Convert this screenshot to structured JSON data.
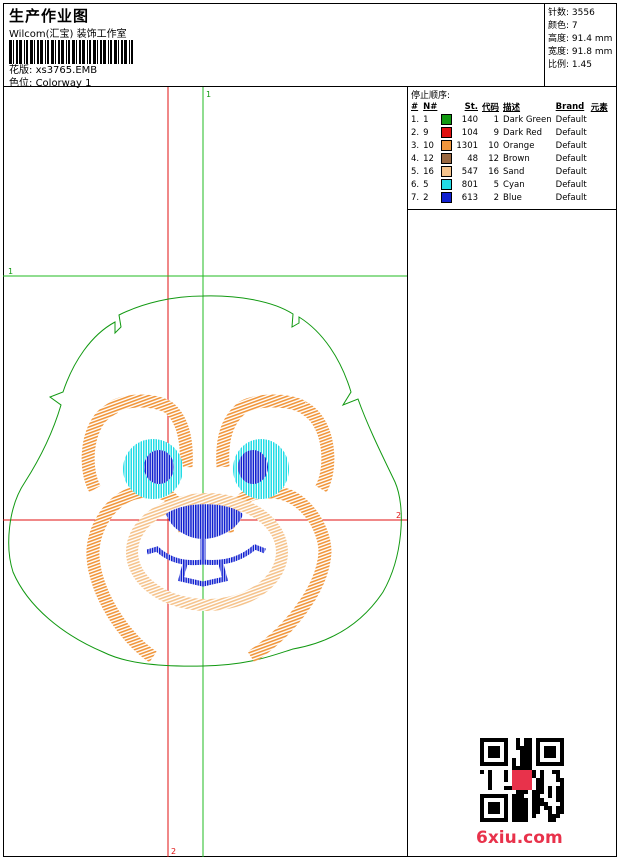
{
  "header": {
    "title": "生产作业图",
    "software": "Wilcom(汇宝) 装饰工作室",
    "design_label": "花版:",
    "design_value": "xs3765.EMB",
    "colorway_label": "色位:",
    "colorway_value": "Colorway 1"
  },
  "stats": [
    {
      "label": "针数:",
      "value": "3556"
    },
    {
      "label": "颜色:",
      "value": "7"
    },
    {
      "label": "高度:",
      "value": "91.4 mm"
    },
    {
      "label": "宽度:",
      "value": "91.8 mm"
    },
    {
      "label": "比例:",
      "value": "1.45"
    }
  ],
  "stop_sequence": {
    "title": "停止顺序:",
    "columns": [
      "#",
      "N#",
      "St.",
      "代码",
      "描述",
      "Brand",
      "元素"
    ],
    "rows": [
      {
        "idx": "1.",
        "n": "1",
        "color": "#119911",
        "st": "140",
        "code": "1",
        "desc": "Dark Green",
        "brand": "Default"
      },
      {
        "idx": "2.",
        "n": "9",
        "color": "#e01010",
        "st": "104",
        "code": "9",
        "desc": "Dark Red",
        "brand": "Default"
      },
      {
        "idx": "3.",
        "n": "10",
        "color": "#f0963c",
        "st": "1301",
        "code": "10",
        "desc": "Orange",
        "brand": "Default"
      },
      {
        "idx": "4.",
        "n": "12",
        "color": "#9a6840",
        "st": "48",
        "code": "12",
        "desc": "Brown",
        "brand": "Default"
      },
      {
        "idx": "5.",
        "n": "16",
        "color": "#f5c38c",
        "st": "547",
        "code": "16",
        "desc": "Sand",
        "brand": "Default"
      },
      {
        "idx": "6.",
        "n": "5",
        "color": "#22dce6",
        "st": "801",
        "code": "5",
        "desc": "Cyan",
        "brand": "Default"
      },
      {
        "idx": "7.",
        "n": "2",
        "color": "#1020d0",
        "st": "613",
        "code": "2",
        "desc": "Blue",
        "brand": "Default"
      }
    ]
  },
  "guides": {
    "v1": "1",
    "h1": "1",
    "h2": "2",
    "v2": "2"
  },
  "colors": {
    "outline": "#119911",
    "orange": "#f0963c",
    "sand": "#f5c38c",
    "cyan": "#22dce6",
    "blue": "#1020d0",
    "red_guide": "#e01010",
    "green_guide": "#22bb22"
  },
  "watermark": {
    "site": "6xiu.com"
  }
}
